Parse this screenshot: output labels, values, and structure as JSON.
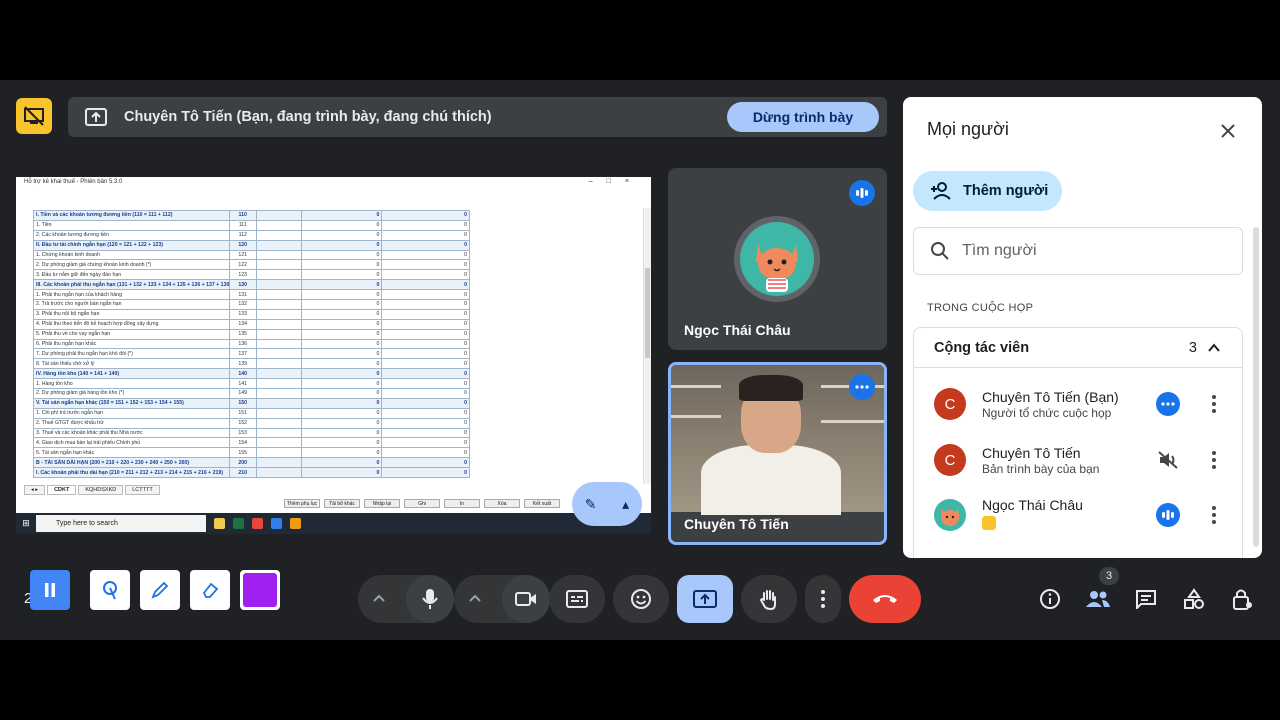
{
  "colors": {
    "accent": "#a8c7fa",
    "hangup": "#ea4335",
    "speaking": "#1a73e8",
    "purple": "#a020f0"
  },
  "banner": {
    "text": "Chuyên Tô Tiến (Bạn, đang trình bày, đang chú thích)",
    "stop_label": "Dừng trình bày"
  },
  "shared_screen": {
    "window_title": "Hỗ trợ kê khai thuế - Phiên bản 5.3.0",
    "rows": [
      {
        "label": "I. Tiền và các khoản tương đương tiền (110 = 111 + 112)",
        "code": "110",
        "v1": "0",
        "v2": "0",
        "bold": true
      },
      {
        "label": "1. Tiền",
        "code": "111",
        "v1": "0",
        "v2": "0"
      },
      {
        "label": "2. Các khoản tương đương tiền",
        "code": "112",
        "v1": "0",
        "v2": "0"
      },
      {
        "label": "II. Đầu tư tài chính ngắn hạn (120 = 121 + 122 + 123)",
        "code": "120",
        "v1": "0",
        "v2": "0",
        "bold": true
      },
      {
        "label": "1. Chứng khoán kinh doanh",
        "code": "121",
        "v1": "0",
        "v2": "0"
      },
      {
        "label": "2. Dự phòng giảm giá chứng khoán kinh doanh (*)",
        "code": "122",
        "v1": "0",
        "v2": "0"
      },
      {
        "label": "3. Đầu tư nắm giữ đến ngày đáo hạn",
        "code": "123",
        "v1": "0",
        "v2": "0"
      },
      {
        "label": "III. Các khoản phải thu ngắn hạn (131 + 132 + 133 + 134 + 135 + 136 + 137 + 139)",
        "code": "130",
        "v1": "0",
        "v2": "0",
        "bold": true
      },
      {
        "label": "1. Phải thu ngắn hạn của khách hàng",
        "code": "131",
        "v1": "0",
        "v2": "0"
      },
      {
        "label": "2. Trả trước cho người bán ngắn hạn",
        "code": "132",
        "v1": "0",
        "v2": "0"
      },
      {
        "label": "3. Phải thu nội bộ ngắn hạn",
        "code": "133",
        "v1": "0",
        "v2": "0"
      },
      {
        "label": "4. Phải thu theo tiến độ kế hoạch hợp đồng xây dựng",
        "code": "134",
        "v1": "0",
        "v2": "0"
      },
      {
        "label": "5. Phải thu về cho vay ngắn hạn",
        "code": "135",
        "v1": "0",
        "v2": "0"
      },
      {
        "label": "6. Phải thu ngắn hạn khác",
        "code": "136",
        "v1": "0",
        "v2": "0"
      },
      {
        "label": "7. Dự phòng phải thu ngắn hạn khó đòi (*)",
        "code": "137",
        "v1": "0",
        "v2": "0"
      },
      {
        "label": "8. Tài sản thiếu chờ xử lý",
        "code": "139",
        "v1": "0",
        "v2": "0"
      },
      {
        "label": "IV. Hàng tồn kho (140 = 141 + 149)",
        "code": "140",
        "v1": "0",
        "v2": "0",
        "bold": true
      },
      {
        "label": "1. Hàng tồn kho",
        "code": "141",
        "v1": "0",
        "v2": "0"
      },
      {
        "label": "2. Dự phòng giảm giá hàng tồn kho (*)",
        "code": "149",
        "v1": "0",
        "v2": "0"
      },
      {
        "label": "V. Tài sản ngắn hạn khác (150 = 151 + 152 + 153 + 154 + 155)",
        "code": "150",
        "v1": "0",
        "v2": "0",
        "bold": true
      },
      {
        "label": "1. Chi phí trả trước ngắn hạn",
        "code": "151",
        "v1": "0",
        "v2": "0"
      },
      {
        "label": "2. Thuế GTGT được khấu trừ",
        "code": "152",
        "v1": "0",
        "v2": "0"
      },
      {
        "label": "3. Thuế và các khoản khác phải thu Nhà nước",
        "code": "153",
        "v1": "0",
        "v2": "0"
      },
      {
        "label": "4. Giao dịch mua bán lại trái phiếu Chính phủ",
        "code": "154",
        "v1": "0",
        "v2": "0"
      },
      {
        "label": "5. Tài sản ngắn hạn khác",
        "code": "155",
        "v1": "0",
        "v2": "0"
      },
      {
        "label": "B - TÀI SẢN DÀI HẠN (200 = 210 + 220 + 230 + 240 + 250 + 260)",
        "code": "200",
        "v1": "0",
        "v2": "0",
        "bold": true
      },
      {
        "label": "I. Các khoản phải thu dài hạn (210 = 211 + 212 + 213 + 214 + 215 + 216 + 219)",
        "code": "210",
        "v1": "0",
        "v2": "0",
        "bold": true
      }
    ],
    "sheet_tabs": [
      "CDKT",
      "KQHDSXKD",
      "LCTTTT"
    ],
    "form_buttons": [
      "Thêm phụ lục",
      "Tải bổ khác",
      "Nhập lại",
      "Ghi",
      "In",
      "Xóa",
      "Kết xuất"
    ],
    "taskbar_search": "Type here to search"
  },
  "tiles": [
    {
      "name": "Ngọc Thái Châu"
    },
    {
      "name": "Chuyên Tô Tiến"
    }
  ],
  "people_panel": {
    "title": "Mọi người",
    "add_label": "Thêm người",
    "search_placeholder": "Tìm người",
    "section_label": "TRONG CUỘC HỌP",
    "group_label": "Cộng tác viên",
    "group_count": "3",
    "members": [
      {
        "initial": "C",
        "name": "Chuyên Tô Tiến (Bạn)",
        "sub": "Người tổ chức cuộc họp"
      },
      {
        "initial": "C",
        "name": "Chuyên Tô Tiến",
        "sub": "Bản trình bày của bạn"
      },
      {
        "initial": "",
        "name": "Ngọc Thái Châu",
        "sub": ""
      }
    ]
  },
  "bottom_bar": {
    "left_text": "2",
    "people_count": "3"
  }
}
